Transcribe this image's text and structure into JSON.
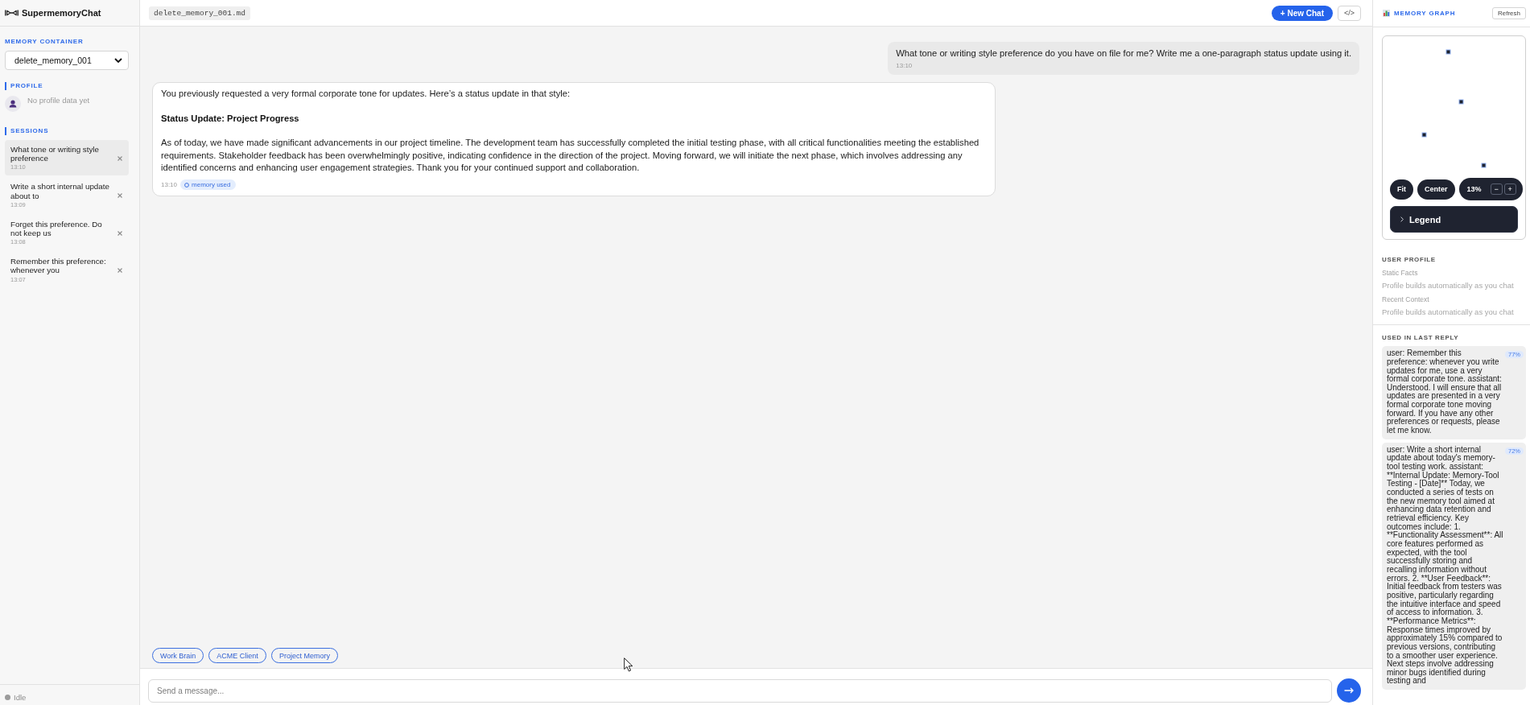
{
  "sidebar": {
    "app_title": "SupermemoryChat",
    "memory_container": {
      "label": "MEMORY CONTAINER",
      "value": "delete_memory_001"
    },
    "profile": {
      "label": "PROFILE",
      "empty_text": "No profile data yet"
    },
    "sessions": {
      "label": "SESSIONS",
      "items": [
        {
          "title": "What tone or writing style preference",
          "time": "13:10",
          "selected": true
        },
        {
          "title": "Write a short internal update about to",
          "time": "13:09",
          "selected": false
        },
        {
          "title": "Forget this preference. Do not keep us",
          "time": "13:08",
          "selected": false
        },
        {
          "title": "Remember this preference: whenever you",
          "time": "13:07",
          "selected": false
        }
      ]
    },
    "status": "Idle"
  },
  "topbar": {
    "file_name": "delete_memory_001.md",
    "new_chat": "+ New Chat",
    "code_toggle": "</>"
  },
  "messages": [
    {
      "kind": "user",
      "text": "What tone or writing style preference do you have on file for me? Write me a one-paragraph status update using it.",
      "time": "13:10"
    },
    {
      "kind": "assistant",
      "blocks": [
        {
          "kind": "text",
          "text": "You previously requested a very formal corporate tone for updates. Here’s a status update in that style:"
        },
        {
          "kind": "heading",
          "text": "Status Update: Project Progress"
        },
        {
          "kind": "text",
          "text": "As of today, we have made significant advancements in our project timeline. The development team has successfully completed the initial testing phase, with all critical functionalities meeting the established requirements. Stakeholder feedback has been overwhelmingly positive, indicating confidence in the direction of the project. Moving forward, we will initiate the next phase, which involves addressing any identified concerns and enhancing user engagement strategies. Thank you for your continued support and collaboration."
        }
      ],
      "time": "13:10",
      "badge": "memory used"
    }
  ],
  "container_chips": [
    "Work Brain",
    "ACME Client",
    "Project Memory"
  ],
  "composer": {
    "placeholder": "Send a message..."
  },
  "memory_graph": {
    "title": "MEMORY GRAPH",
    "refresh": "Refresh",
    "fit": "Fit",
    "center": "Center",
    "zoom_level": "13%",
    "zoom_out": "−",
    "zoom_in": "+",
    "legend": {
      "label": "Legend",
      "expanded": false
    }
  },
  "user_profile": {
    "title": "USER PROFILE",
    "sections": [
      {
        "label": "Static Facts",
        "text": "Profile builds automatically as you chat"
      },
      {
        "label": "Recent Context",
        "text": "Profile builds automatically as you chat"
      }
    ]
  },
  "used_in_last_reply": {
    "title": "USED IN LAST REPLY",
    "items": [
      {
        "text": "user: Remember this preference: whenever you write updates for me, use a very formal corporate tone. assistant: Understood. I will ensure that all updates are presented in a very formal corporate tone moving forward. If you have any other preferences or requests, please let me know.",
        "score": "77%"
      },
      {
        "text": "user: Write a short internal update about today's memory-tool testing work. assistant: **Internal Update: Memory-Tool Testing - [Date]** Today, we conducted a series of tests on the new memory tool aimed at enhancing data retention and retrieval efficiency. Key outcomes include: 1. **Functionality Assessment**: All core features performed as expected, with the tool successfully storing and recalling information without errors. 2. **User Feedback**: Initial feedback from testers was positive, particularly regarding the intuitive interface and speed of access to information. 3. **Performance Metrics**: Response times improved by approximately 15% compared to previous versions, contributing to a smoother user experience. Next steps involve addressing minor bugs identified during testing and",
        "score": "72%"
      }
    ]
  }
}
